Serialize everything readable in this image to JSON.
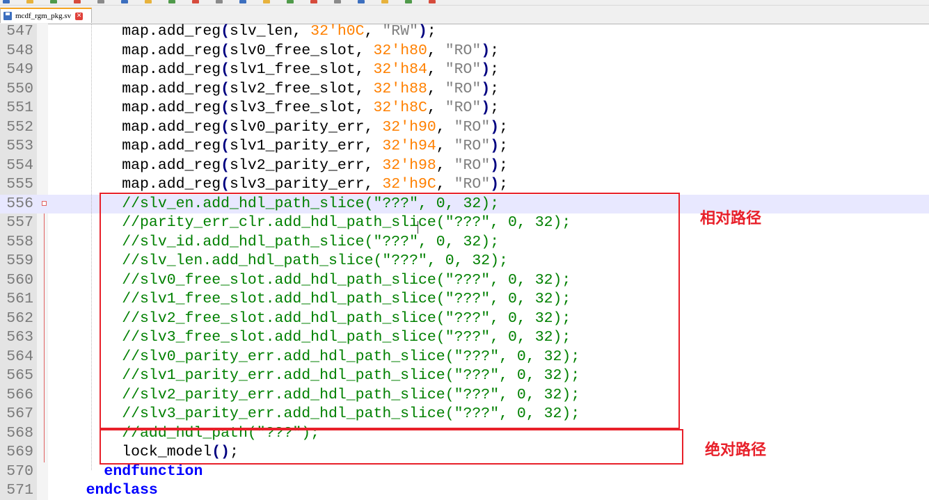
{
  "toolbar": {
    "icons": [
      "new-icon",
      "open-icon",
      "save-icon",
      "save-all-icon",
      "close-icon",
      "print-icon",
      "cut-icon",
      "copy-icon",
      "paste-icon",
      "undo-icon",
      "redo-icon",
      "find-icon",
      "replace-icon",
      "zoom-in-icon",
      "zoom-out-icon",
      "sync-icon",
      "wrap-icon",
      "indent-icon",
      "macro-icon"
    ]
  },
  "tab": {
    "label": "mcdf_rgm_pkg.sv",
    "close_glyph": "✕"
  },
  "code_lines": [
    {
      "num": "547",
      "text": "        map.add_reg(slv_len, 32'h0C, \"RW\");"
    },
    {
      "num": "548",
      "text": "        map.add_reg(slv0_free_slot, 32'h80, \"RO\");"
    },
    {
      "num": "549",
      "text": "        map.add_reg(slv1_free_slot, 32'h84, \"RO\");"
    },
    {
      "num": "550",
      "text": "        map.add_reg(slv2_free_slot, 32'h88, \"RO\");"
    },
    {
      "num": "551",
      "text": "        map.add_reg(slv3_free_slot, 32'h8C, \"RO\");"
    },
    {
      "num": "552",
      "text": "        map.add_reg(slv0_parity_err, 32'h90, \"RO\");"
    },
    {
      "num": "553",
      "text": "        map.add_reg(slv1_parity_err, 32'h94, \"RO\");"
    },
    {
      "num": "554",
      "text": "        map.add_reg(slv2_parity_err, 32'h98, \"RO\");"
    },
    {
      "num": "555",
      "text": "        map.add_reg(slv3_parity_err, 32'h9C, \"RO\");"
    },
    {
      "num": "556",
      "text": "        //slv_en.add_hdl_path_slice(\"???\", 0, 32);"
    },
    {
      "num": "557",
      "text": "        //parity_err_clr.add_hdl_path_slice(\"???\", 0, 32);"
    },
    {
      "num": "558",
      "text": "        //slv_id.add_hdl_path_slice(\"???\", 0, 32);"
    },
    {
      "num": "559",
      "text": "        //slv_len.add_hdl_path_slice(\"???\", 0, 32);"
    },
    {
      "num": "560",
      "text": "        //slv0_free_slot.add_hdl_path_slice(\"???\", 0, 32);"
    },
    {
      "num": "561",
      "text": "        //slv1_free_slot.add_hdl_path_slice(\"???\", 0, 32);"
    },
    {
      "num": "562",
      "text": "        //slv2_free_slot.add_hdl_path_slice(\"???\", 0, 32);"
    },
    {
      "num": "563",
      "text": "        //slv3_free_slot.add_hdl_path_slice(\"???\", 0, 32);"
    },
    {
      "num": "564",
      "text": "        //slv0_parity_err.add_hdl_path_slice(\"???\", 0, 32);"
    },
    {
      "num": "565",
      "text": "        //slv1_parity_err.add_hdl_path_slice(\"???\", 0, 32);"
    },
    {
      "num": "566",
      "text": "        //slv2_parity_err.add_hdl_path_slice(\"???\", 0, 32);"
    },
    {
      "num": "567",
      "text": "        //slv3_parity_err.add_hdl_path_slice(\"???\", 0, 32);"
    },
    {
      "num": "568",
      "text": "        //add_hdl_path(\"???\");"
    },
    {
      "num": "569",
      "text": "        lock_model();"
    },
    {
      "num": "570",
      "text": "      endfunction"
    },
    {
      "num": "571",
      "text": "    endclass"
    }
  ],
  "annotations": {
    "relative_path": "相对路径",
    "absolute_path": "绝对路径"
  },
  "colors": {
    "keyword": "#0000ff",
    "number": "#ff8000",
    "string": "#808080",
    "comment": "#008000",
    "annotation": "#e8202a",
    "current_line": "#e8e8ff"
  }
}
